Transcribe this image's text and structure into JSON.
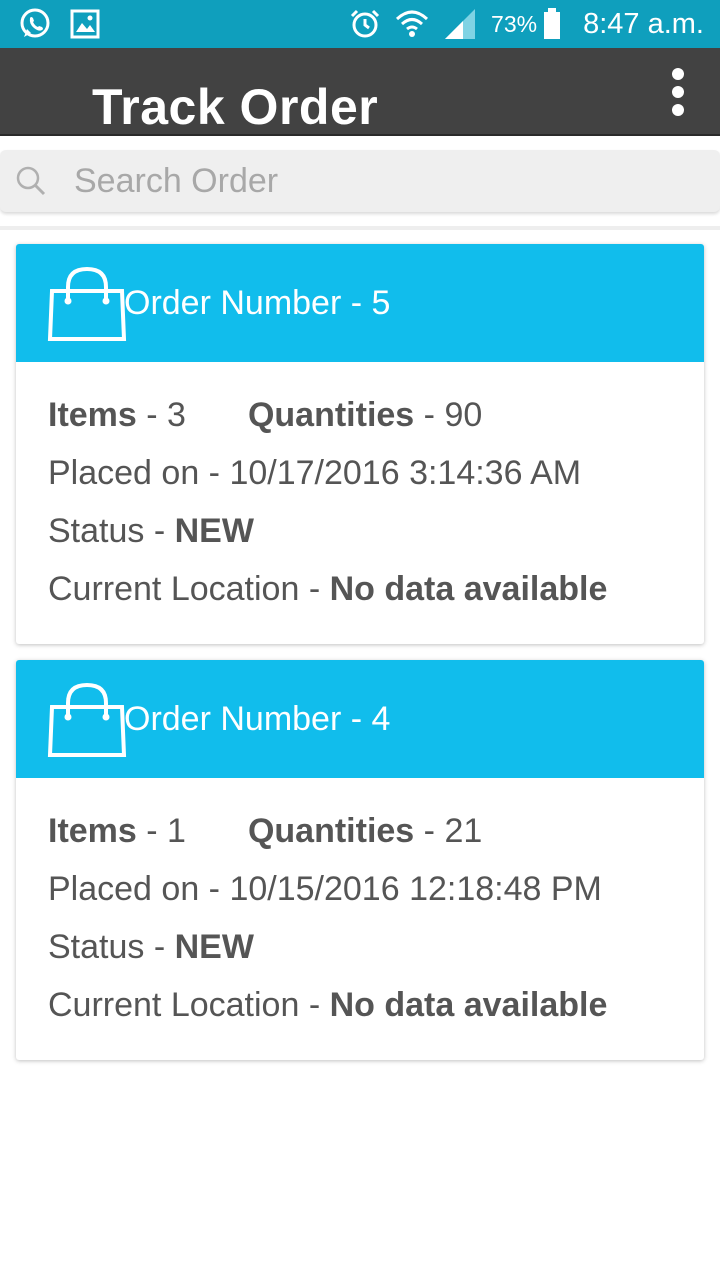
{
  "status_bar": {
    "battery_percent": "73%",
    "time": "8:47 a.m.",
    "icons": [
      "whatsapp-icon",
      "image-icon",
      "alarm-icon",
      "wifi-icon",
      "signal-icon",
      "battery-icon"
    ]
  },
  "app_bar": {
    "title": "Track Order",
    "menu_icon": "more-vertical-icon"
  },
  "search": {
    "placeholder": "Search Order",
    "value": ""
  },
  "labels": {
    "items": "Items",
    "quantities": "Quantities",
    "placed_on": "Placed on",
    "status": "Status",
    "current_location": "Current Location",
    "separator": " - "
  },
  "orders": [
    {
      "header": "Order Number - 5",
      "items": "3",
      "quantities": "90",
      "placed_on": "10/17/2016 3:14:36 AM",
      "status": "NEW",
      "current_location": "No data available"
    },
    {
      "header": "Order Number - 4",
      "items": "1",
      "quantities": "21",
      "placed_on": "10/15/2016 12:18:48 PM",
      "status": "NEW",
      "current_location": "No data available"
    }
  ],
  "colors": {
    "status_bar": "#0f9fbd",
    "app_bar": "#424242",
    "card_header": "#11bdec",
    "body_text": "#555555"
  }
}
